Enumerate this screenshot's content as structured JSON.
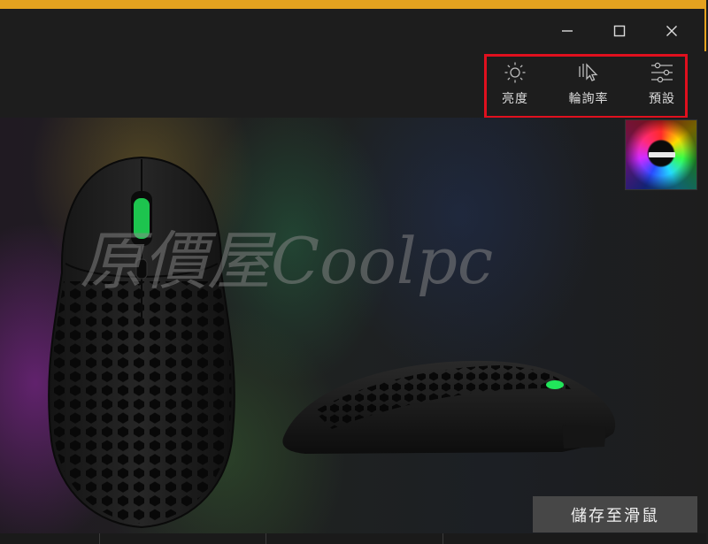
{
  "window": {
    "controls": {
      "minimize_icon": "minimize-icon",
      "maximize_icon": "maximize-icon",
      "close_icon": "close-icon"
    },
    "frame_color": "#e4a21f"
  },
  "toolbar": {
    "items": [
      {
        "label": "亮度",
        "icon": "sun-icon"
      },
      {
        "label": "輪詢率",
        "icon": "cursor-click-icon"
      },
      {
        "label": "預設",
        "icon": "sliders-icon"
      }
    ],
    "highlight_color": "#e0101e"
  },
  "preview": {
    "thumbnail": "rgb-wallpaper-thumbnail"
  },
  "watermark": {
    "text": "原價屋Coolpc"
  },
  "actions": {
    "save_label": "儲存至滑鼠"
  }
}
